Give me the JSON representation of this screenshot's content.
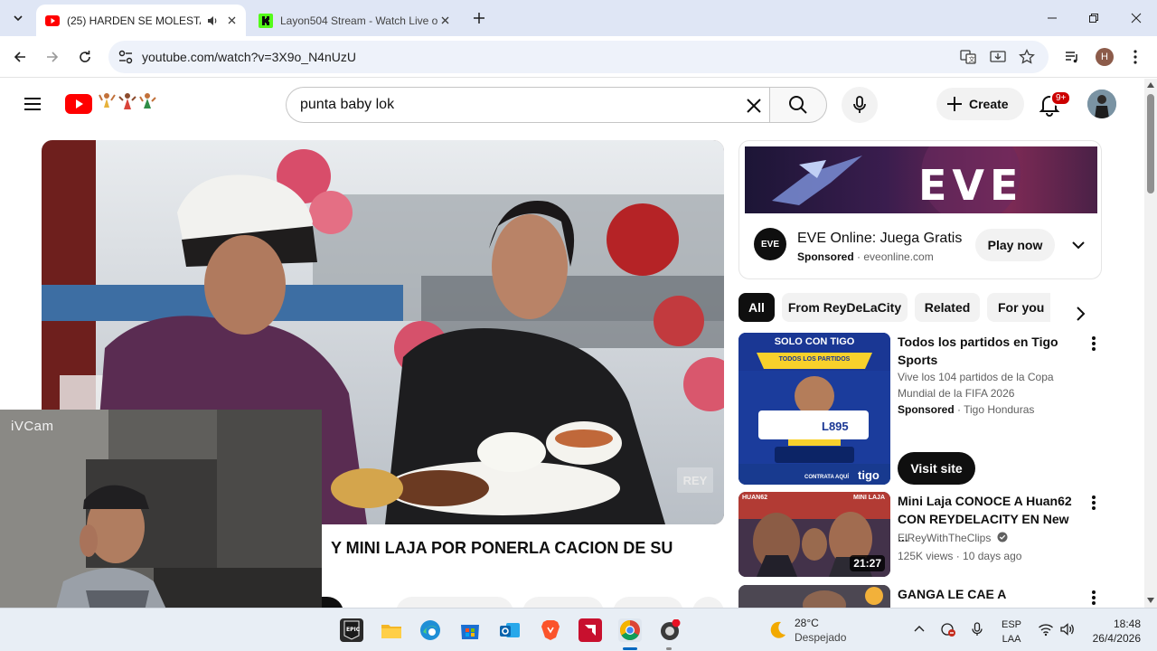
{
  "browser": {
    "tabs": [
      {
        "title": "(25) HARDEN SE MOLESTA",
        "active": true
      },
      {
        "title": "Layon504 Stream - Watch Live o",
        "active": false
      }
    ],
    "url": "youtube.com/watch?v=3X9o_N4nUzU",
    "profile_initial": "H"
  },
  "masthead": {
    "search_value": "punta baby lok",
    "create_label": "Create",
    "notification_count": "9+"
  },
  "video": {
    "title": "Y MINI LAJA POR PONERLA CACION DE SU",
    "watermark": "REY"
  },
  "webcam": {
    "label": "iVCam"
  },
  "ad": {
    "banner_text": "EVE",
    "logo_text": "EVE",
    "title": "EVE Online: Juega Gratis",
    "sponsored": "Sponsored",
    "domain": "eveonline.com",
    "cta": "Play now"
  },
  "chips": [
    "All",
    "From ReyDeLaCity",
    "Related",
    "For you"
  ],
  "recommendations": [
    {
      "title": "Todos los partidos en Tigo Sports",
      "description": "Vive los 104 partidos de la Copa Mundial de la FIFA 2026",
      "sponsored": "Sponsored",
      "channel": "Tigo Honduras",
      "cta": "Visit site",
      "thumb_text": {
        "top": "SOLO CON TIGO",
        "sub": "TODOS LOS PARTIDOS",
        "price": "L895",
        "brand": "tigo",
        "contrata": "CONTRATA AQUÍ"
      }
    },
    {
      "title": "Mini Laja CONOCE A Huan62 CON REYDELACITY EN New ...",
      "channel": "ElReyWithTheClips",
      "views": "125K views",
      "age": "10 days ago",
      "duration": "21:27",
      "thumb_text": {
        "left": "HUAN62",
        "right": "MINI LAJA"
      }
    },
    {
      "title": "GANGA LE CAE A REYDELACITY"
    }
  ],
  "taskbar": {
    "weather_temp": "28°C",
    "weather_desc": "Despejado",
    "lang_top": "ESP",
    "lang_bottom": "LAA",
    "time": "18:48",
    "date": "26/4/2026"
  }
}
